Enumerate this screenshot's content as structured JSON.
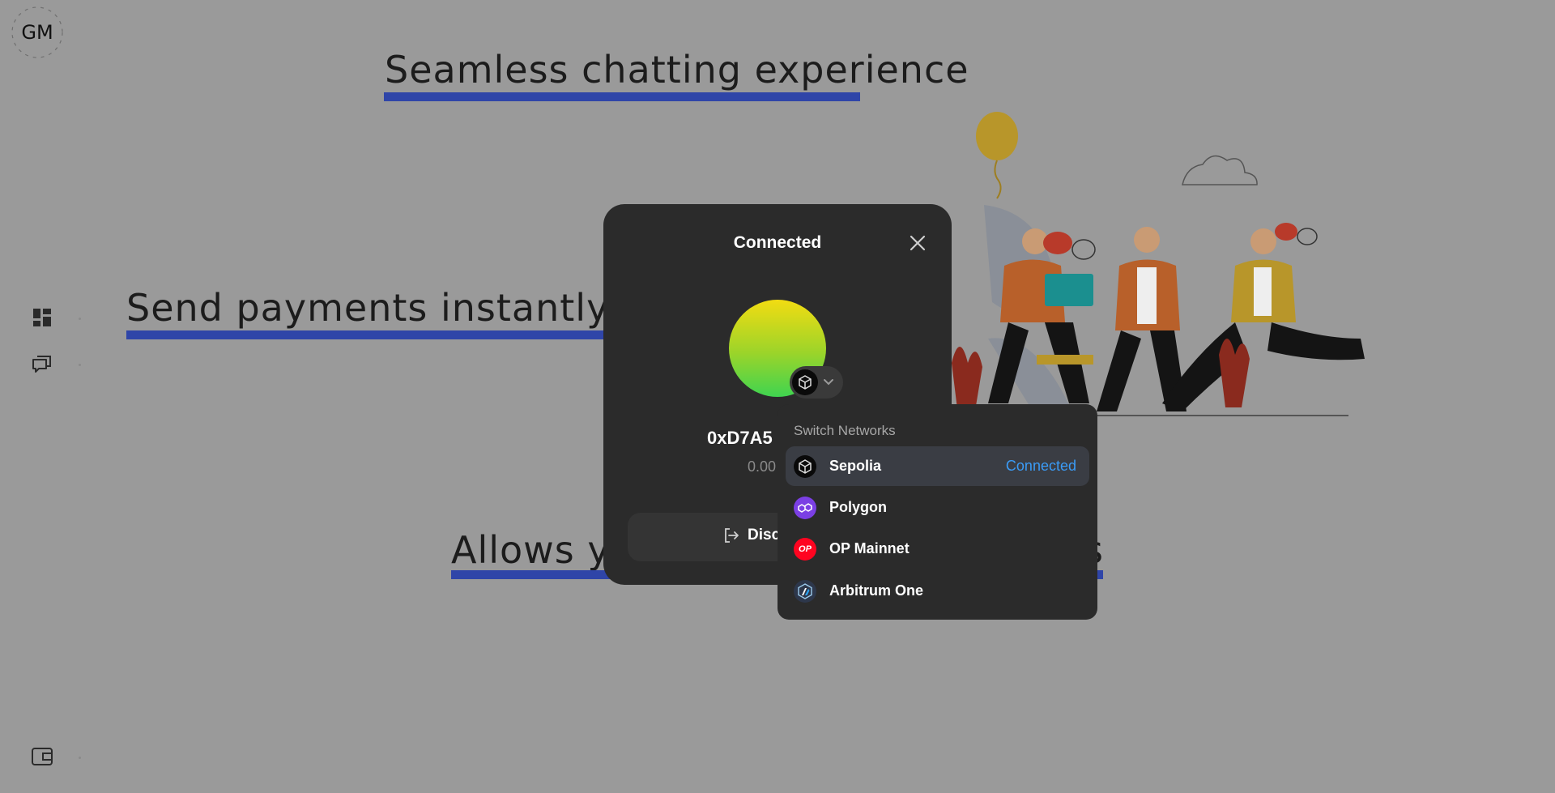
{
  "app": {
    "logo_text": "GM"
  },
  "sidebar": {
    "items": [
      {
        "icon": "dashboard-icon"
      },
      {
        "icon": "chat-icon"
      }
    ],
    "bottom_icon": "wallet-icon"
  },
  "hero": {
    "headline_1": "Seamless chatting experience",
    "headline_2": "Send payments instantly throu",
    "headline_3_left": "Allows yo",
    "headline_3_right": "s"
  },
  "modal": {
    "title": "Connected",
    "address": "0xD7A5",
    "balance": "0.00",
    "disconnect_label": "Disc",
    "colors": {
      "accent": "#3b9bf5",
      "background": "#2b2b2b"
    }
  },
  "network_menu": {
    "header": "Switch Networks",
    "items": [
      {
        "label": "Sepolia",
        "status": "Connected",
        "icon": "sepolia-icon",
        "color": "#0a0a0a"
      },
      {
        "label": "Polygon",
        "status": "",
        "icon": "polygon-icon",
        "color": "#7b3fe4"
      },
      {
        "label": "OP Mainnet",
        "status": "",
        "icon": "op-icon",
        "icon_text": "OP",
        "color": "#ff0420"
      },
      {
        "label": "Arbitrum One",
        "status": "",
        "icon": "arbitrum-icon",
        "color": "#2d374b"
      }
    ]
  }
}
